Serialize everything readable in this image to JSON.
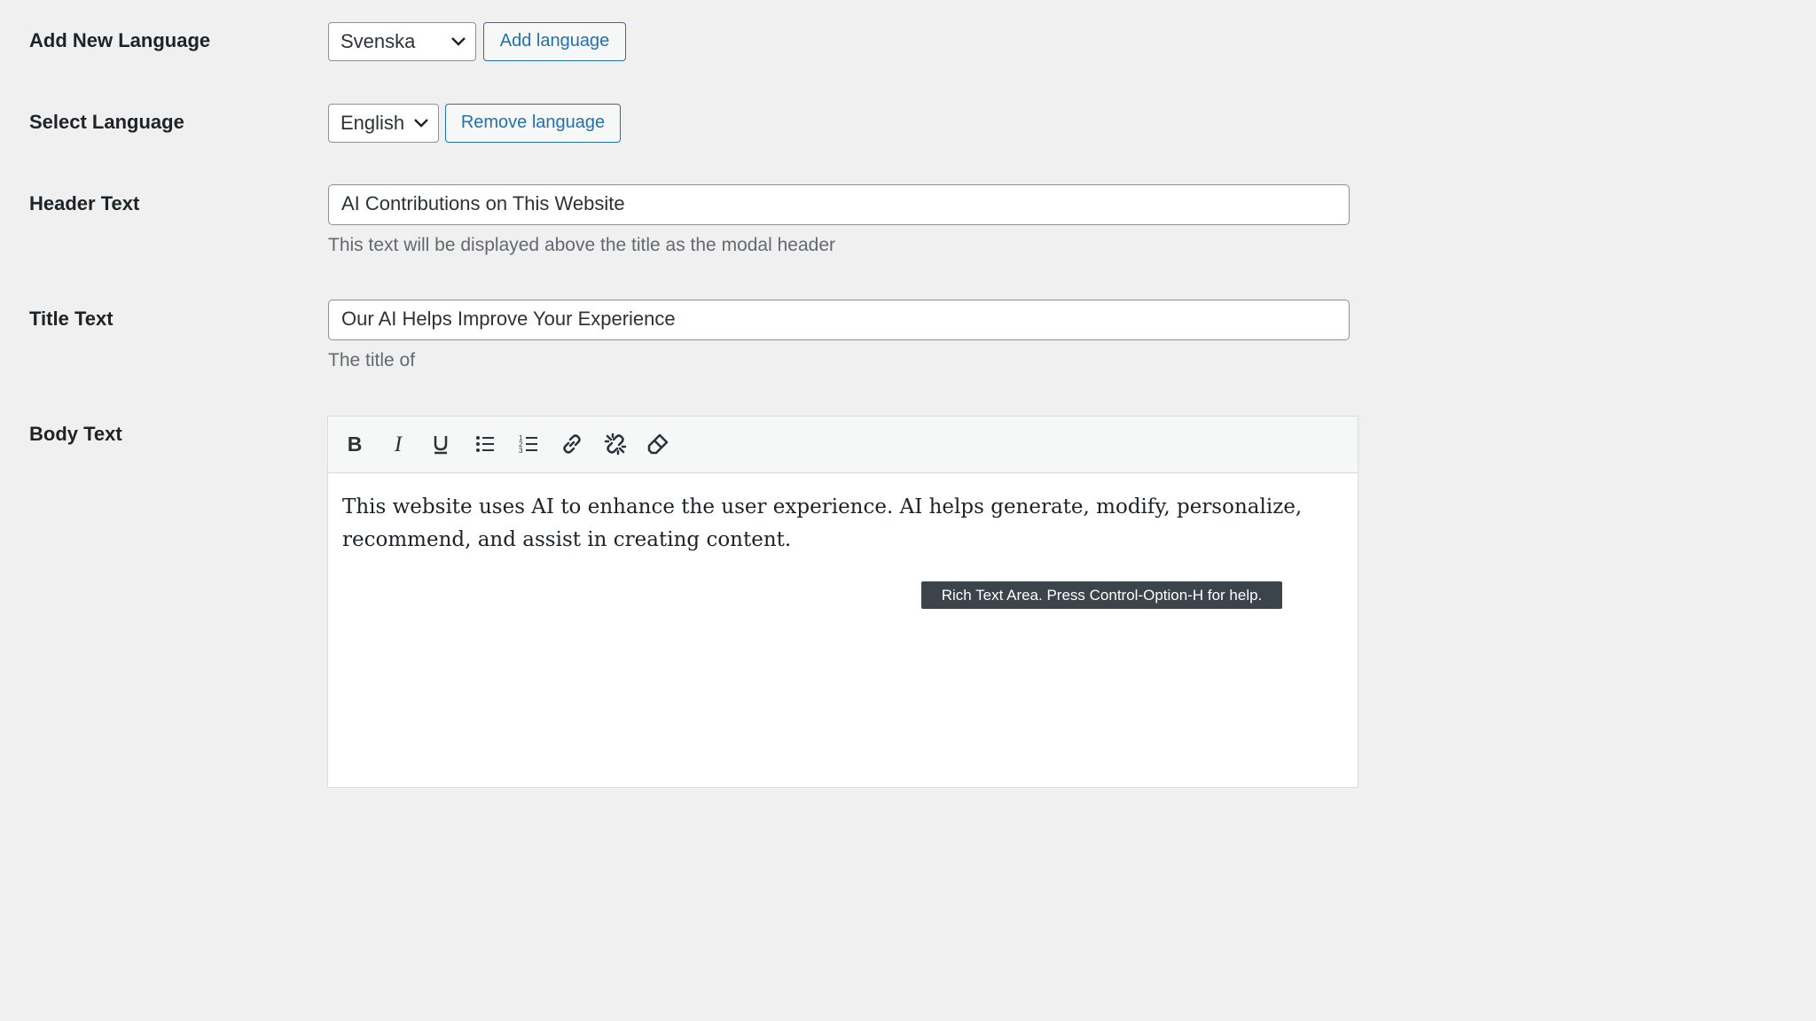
{
  "add_language": {
    "label": "Add New Language",
    "select_value": "Svenska",
    "button": "Add language"
  },
  "select_language": {
    "label": "Select Language",
    "select_value": "English",
    "button": "Remove language"
  },
  "header_text": {
    "label": "Header Text",
    "value": "AI Contributions on This Website",
    "description": "This text will be displayed above the title as the modal header"
  },
  "title_text": {
    "label": "Title Text",
    "value": "Our AI Helps Improve Your Experience",
    "description": "The title of"
  },
  "body_text": {
    "label": "Body Text",
    "toolbar": [
      "bold-icon",
      "italic-icon",
      "underline-icon",
      "bullet-list-icon",
      "numbered-list-icon",
      "link-icon",
      "unlink-icon",
      "eraser-icon"
    ],
    "content": "This website uses AI to enhance the user experience. AI helps generate, modify, personalize, recommend, and assist in creating content.",
    "tooltip": "Rich Text Area. Press Control-Option-H for help."
  }
}
